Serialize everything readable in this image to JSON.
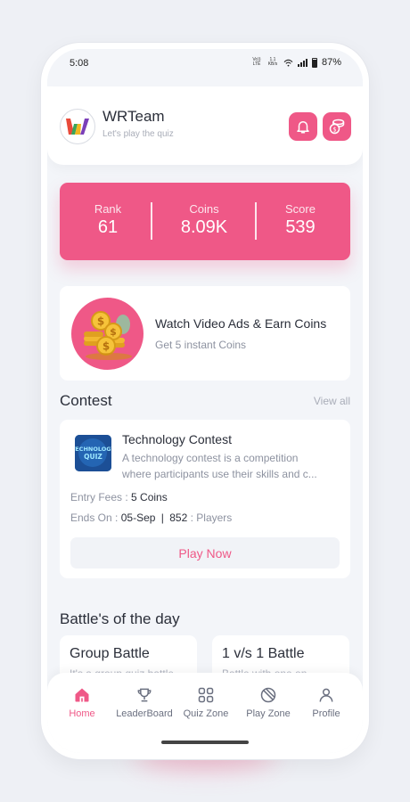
{
  "status_bar": {
    "time": "5:08",
    "network_type": "Vo)) LTE",
    "speed": "1.1 KB/s",
    "battery": "87%"
  },
  "header": {
    "title": "WRTeam",
    "subtitle": "Let's play the quiz",
    "logo_letter": "W"
  },
  "stats": [
    {
      "label": "Rank",
      "value": "61"
    },
    {
      "label": "Coins",
      "value": "8.09K"
    },
    {
      "label": "Score",
      "value": "539"
    }
  ],
  "ads_card": {
    "title": "Watch Video Ads & Earn Coins",
    "subtitle": "Get 5 instant Coins"
  },
  "contest_section": {
    "title": "Contest",
    "view_all": "View all"
  },
  "contest": {
    "thumb_text": "TECHNOLOGY QUIZ",
    "title": "Technology Contest",
    "description_line1": "A technology contest is a competition",
    "description_line2": "where participants use their skills and c...",
    "entry_label": "Entry Fees :",
    "entry_value": "5 Coins",
    "ends_label": "Ends On :",
    "ends_value": "05-Sep",
    "separator": "|",
    "players_value": "852",
    "players_label": ": Players",
    "button": "Play Now"
  },
  "battles_section": {
    "title": "Battle's of the day"
  },
  "battles": [
    {
      "title": "Group Battle",
      "description": "It's a group quiz battle"
    },
    {
      "title": "1 v/s 1 Battle",
      "description": "Battle with one on"
    }
  ],
  "bottom_nav": [
    {
      "label": "Home",
      "icon": "home-icon",
      "active": true
    },
    {
      "label": "LeaderBoard",
      "icon": "trophy-icon",
      "active": false
    },
    {
      "label": "Quiz Zone",
      "icon": "grid-icon",
      "active": false
    },
    {
      "label": "Play Zone",
      "icon": "ball-icon",
      "active": false
    },
    {
      "label": "Profile",
      "icon": "user-icon",
      "active": false
    }
  ],
  "colors": {
    "accent": "#ef5887",
    "background": "#f3f5f9",
    "text": "#2b2f3a",
    "muted": "#8d92a0"
  }
}
